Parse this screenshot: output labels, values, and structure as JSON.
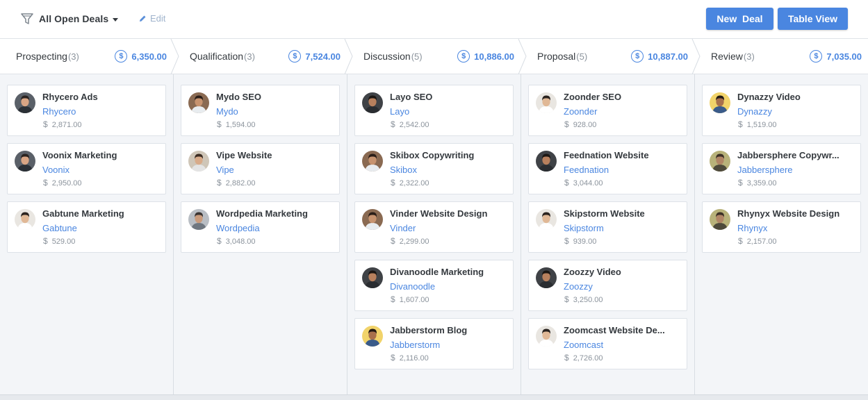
{
  "header": {
    "filter_label": "All Open Deals",
    "edit_label": "Edit",
    "new_deal_label": "New  Deal",
    "table_view_label": "Table View"
  },
  "colors": {
    "accent": "#4a86e0",
    "text": "#34393e",
    "muted": "#8b939c"
  },
  "currency_symbol": "$",
  "stages": [
    {
      "name": "Prospecting",
      "count": "(3)",
      "total": "6,350.00"
    },
    {
      "name": "Qualification",
      "count": "(3)",
      "total": "7,524.00"
    },
    {
      "name": "Discussion",
      "count": "(5)",
      "total": "10,886.00"
    },
    {
      "name": "Proposal",
      "count": "(5)",
      "total": "10,887.00"
    },
    {
      "name": "Review",
      "count": "(3)",
      "total": "7,035.00"
    }
  ],
  "deals": [
    [
      {
        "title": "Rhycero Ads",
        "org": "Rhycero",
        "value": "2,871.00",
        "avatar": "avatar-man-dark-shirt"
      },
      {
        "title": "Voonix Marketing",
        "org": "Voonix",
        "value": "2,950.00",
        "avatar": "avatar-man-dark-shirt"
      },
      {
        "title": "Gabtune Marketing",
        "org": "Gabtune",
        "value": "529.00",
        "avatar": "avatar-man-light"
      }
    ],
    [
      {
        "title": "Mydo SEO",
        "org": "Mydo",
        "value": "1,594.00",
        "avatar": "avatar-man-brown"
      },
      {
        "title": "Vipe Website",
        "org": "Vipe",
        "value": "2,882.00",
        "avatar": "avatar-man-glasses"
      },
      {
        "title": "Wordpedia Marketing",
        "org": "Wordpedia",
        "value": "3,048.00",
        "avatar": "avatar-man-grey"
      }
    ],
    [
      {
        "title": "Layo SEO",
        "org": "Layo",
        "value": "2,542.00",
        "avatar": "avatar-man-dark"
      },
      {
        "title": "Skibox Copywriting",
        "org": "Skibox",
        "value": "2,322.00",
        "avatar": "avatar-man-brown"
      },
      {
        "title": "Vinder Website Design",
        "org": "Vinder",
        "value": "2,299.00",
        "avatar": "avatar-man-brown"
      },
      {
        "title": "Divanoodle Marketing",
        "org": "Divanoodle",
        "value": "1,607.00",
        "avatar": "avatar-man-dark"
      },
      {
        "title": "Jabberstorm Blog",
        "org": "Jabberstorm",
        "value": "2,116.00",
        "avatar": "avatar-man-yellow"
      }
    ],
    [
      {
        "title": "Zoonder SEO",
        "org": "Zoonder",
        "value": "928.00",
        "avatar": "avatar-man-light"
      },
      {
        "title": "Feednation Website",
        "org": "Feednation",
        "value": "3,044.00",
        "avatar": "avatar-man-dark"
      },
      {
        "title": "Skipstorm Website",
        "org": "Skipstorm",
        "value": "939.00",
        "avatar": "avatar-man-light"
      },
      {
        "title": "Zoozzy Video",
        "org": "Zoozzy",
        "value": "3,250.00",
        "avatar": "avatar-man-dark"
      },
      {
        "title": "Zoomcast Website De...",
        "org": "Zoomcast",
        "value": "2,726.00",
        "avatar": "avatar-man-light"
      }
    ],
    [
      {
        "title": "Dynazzy Video",
        "org": "Dynazzy",
        "value": "1,519.00",
        "avatar": "avatar-man-yellow"
      },
      {
        "title": "Jabbersphere Copywr...",
        "org": "Jabbersphere",
        "value": "3,359.00",
        "avatar": "avatar-man-olive"
      },
      {
        "title": "Rhynyx Website Design",
        "org": "Rhynyx",
        "value": "2,157.00",
        "avatar": "avatar-man-olive"
      }
    ]
  ]
}
